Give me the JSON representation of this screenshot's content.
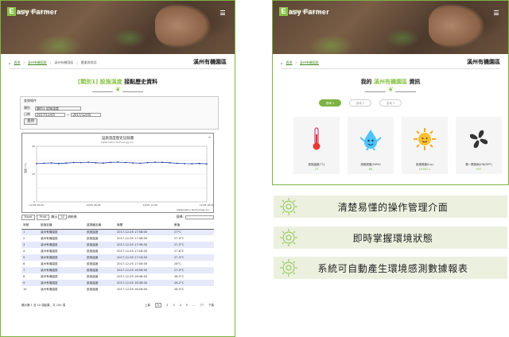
{
  "brand": {
    "name": "Easy Farmer",
    "box_letter": "E",
    "name_rest": "asy Farmer",
    "tagline": "智慧農業 輕鬆管理 Easy"
  },
  "left": {
    "breadcrumb": [
      "首頁",
      "溪州有機園區",
      "溪州有機園區",
      "農業與栽培"
    ],
    "page_heading": "溪州有機園區",
    "title_prefix": "[類別1]",
    "title_highlight": "設施溫度",
    "title_suffix": "接點歷史資料",
    "query": {
      "panel_title": "查詢條件",
      "type_label": "類別",
      "type_value": "類別1-設施溫度",
      "date_label": "日期",
      "date_from": "2017/12/05",
      "date_to": "2017/12/05",
      "query_button": "查詢"
    },
    "chart": {
      "title": "設施溫度歷史記錄圖",
      "subtitle": "Datamation Technology Inc.",
      "credit": "Datamation Technology Inc.",
      "ylabel": "溫度 (°C)"
    },
    "table_controls": {
      "copy": "Excel",
      "print": "Print",
      "show_label": "顯示",
      "show_value": "10",
      "entries_label": "項結果",
      "search_label": "搜尋:"
    },
    "table": {
      "headers": [
        "序號",
        "設施名稱",
        "感測器名稱",
        "時間",
        "數值"
      ],
      "rows": [
        [
          "1",
          "溪州有機園區",
          "設施溫度",
          "2017-12-05 17:58:00",
          "27°C"
        ],
        [
          "2",
          "溪州有機園區",
          "設施溫度",
          "2017-12-05 17:48:00",
          "27.4°C"
        ],
        [
          "3",
          "溪州有機園區",
          "設施溫度",
          "2017-12-05 17:38:00",
          "27.5°C"
        ],
        [
          "4",
          "溪州有機園區",
          "設施溫度",
          "2017-12-05 17:28:00",
          "27.6°C"
        ],
        [
          "5",
          "溪州有機園區",
          "設施溫度",
          "2017-12-05 17:18:00",
          "27.3°C"
        ],
        [
          "6",
          "溪州有機園區",
          "設施溫度",
          "2017-12-05 17:08:00",
          "28°C"
        ],
        [
          "7",
          "溪州有機園區",
          "設施溫度",
          "2017-12-05 16:58:00",
          "27.9°C"
        ],
        [
          "8",
          "溪州有機園區",
          "設施溫度",
          "2017-12-05 16:48:00",
          "28.3°C"
        ],
        [
          "9",
          "溪州有機園區",
          "設施溫度",
          "2017-12-05 16:38:00",
          "28.2°C"
        ],
        [
          "10",
          "溪州有機園區",
          "設施溫度",
          "2017-12-05 16:28:00",
          "28.3°C"
        ]
      ]
    },
    "footer": {
      "info": "顯示第 1 至 10 項結果，共 100 項",
      "prev": "上頁",
      "pages": [
        "1",
        "2",
        "3",
        "4",
        "5",
        "…",
        "77"
      ],
      "next": "下頁"
    }
  },
  "right": {
    "breadcrumb": [
      "首頁",
      "溪州有機園區"
    ],
    "page_heading": "溪州有機園區",
    "title_prefix": "我的",
    "title_highlight": "溪州有機園區",
    "title_suffix": "資訊",
    "tabs": [
      "區域 1",
      "區域 2",
      "區域 3"
    ],
    "cards": [
      {
        "icon": "thermometer-icon",
        "label": "設施溫度(°C)",
        "value": "27"
      },
      {
        "icon": "droplet-mascot-icon",
        "label": "設施濕度(%RH)",
        "value": "66"
      },
      {
        "icon": "sun-icon",
        "label": "設施照度(lux)",
        "value": "10783.1"
      },
      {
        "icon": "fan-icon",
        "label": "第一層風扇(ON/OFF)",
        "value": "OFF"
      }
    ]
  },
  "features": [
    "清楚易懂的操作管理介面",
    "即時掌握環境狀態",
    "系統可自動產生環境感測數據報表"
  ],
  "chart_data": {
    "type": "line",
    "title": "設施溫度歷史記錄圖",
    "ylabel": "溫度 (°C)",
    "x": [
      "12/05 00:00",
      "12/05 06:00",
      "12/05 12:00",
      "12/05 18:00"
    ],
    "ylim": [
      0,
      40
    ],
    "series": [
      {
        "values": [
          27.5,
          27.8,
          28.0,
          27.6,
          27.9,
          28.3,
          28.2,
          28.5,
          28.1,
          27.9,
          28.4,
          28.6,
          28.3,
          28.0,
          27.8,
          28.2,
          28.5,
          28.4,
          28.1,
          27.7,
          27.5,
          27.4,
          27.6,
          27.3
        ]
      }
    ],
    "colors": {
      "line": "#1f3fa8"
    }
  },
  "colors": {
    "accent": "#7cb342",
    "border": "#7cb342",
    "feature_bg": "#ecf0df"
  }
}
